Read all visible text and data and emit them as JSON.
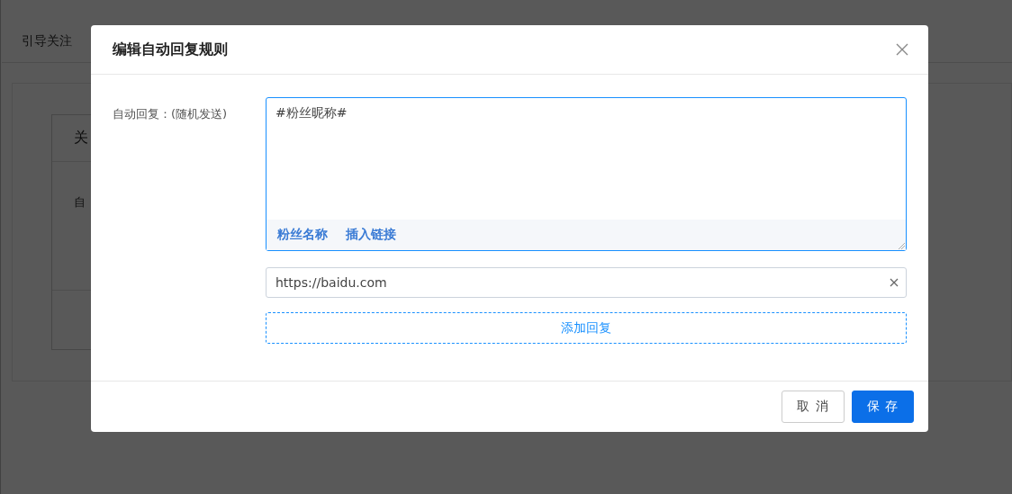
{
  "background": {
    "tab": "引导关注",
    "card_header": "关",
    "card_label": "自"
  },
  "dialog": {
    "title": "编辑自动回复规则",
    "field_label": "自动回复：(随机发送)",
    "reply_text": "#粉丝昵称#",
    "insert_links": [
      "粉丝名称",
      "插入链接"
    ],
    "link_value": "https://baidu.com",
    "add_button": "添加回复",
    "buttons": [
      {
        "label": "取 消",
        "kind": "default"
      },
      {
        "label": "保 存",
        "kind": "primary"
      }
    ]
  }
}
